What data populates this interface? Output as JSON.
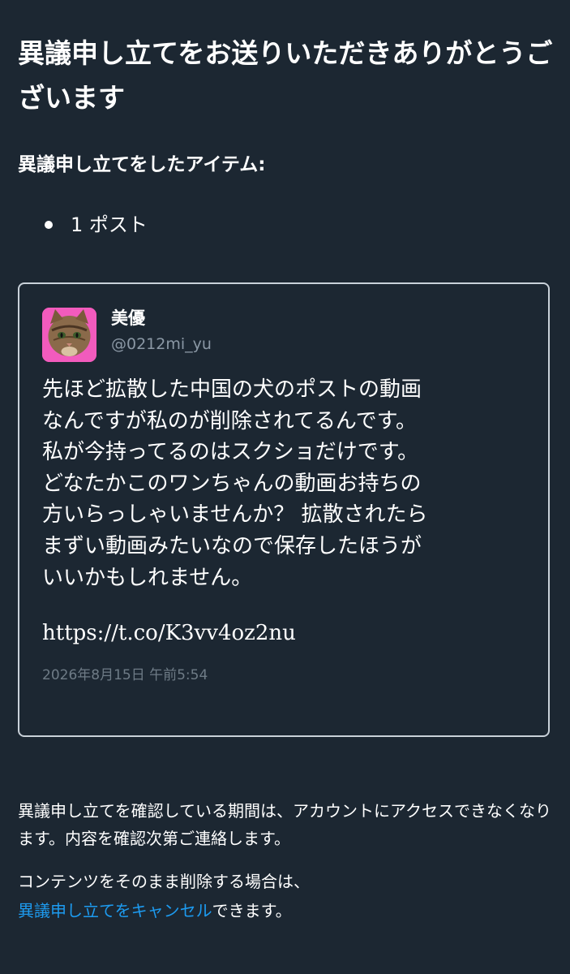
{
  "page": {
    "title": "異議申し立てをお送りいただきありがとうございます",
    "items_heading": "異議申し立てをしたアイテム:",
    "items": [
      "1 ポスト"
    ]
  },
  "post": {
    "display_name": "美優",
    "handle": "@0212mi_yu",
    "avatar_icon": "cat-photo-avatar",
    "avatar_bg": "#f25bbd",
    "text": "先ほど拡散した中国の犬のポストの動画\nなんですが私のが削除されてるんです。\n私が今持ってるのはスクショだけです。\nどなたかこのワンちゃんの動画お持ちの\n方いらっしゃいませんか？ 拡散されたら\nまずい動画みたいなので保存したほうが\nいいかもしれません。",
    "link": "https://t.co/K3vv4oz2nu",
    "timestamp": "2026年8月15日 午前5:54"
  },
  "footer": {
    "notice": "異議申し立てを確認している期間は、アカウントにアクセスできなくなります。内容を確認次第ご連絡します。",
    "cancel_prefix": "コンテンツをそのまま削除する場合は、",
    "cancel_link": "異議申し立てをキャンセル",
    "cancel_suffix": "できます。"
  },
  "colors": {
    "background": "#1c2732",
    "link_blue": "#1d9bf0",
    "muted_text": "#8b98a5",
    "card_border": "#c9d1d9"
  }
}
